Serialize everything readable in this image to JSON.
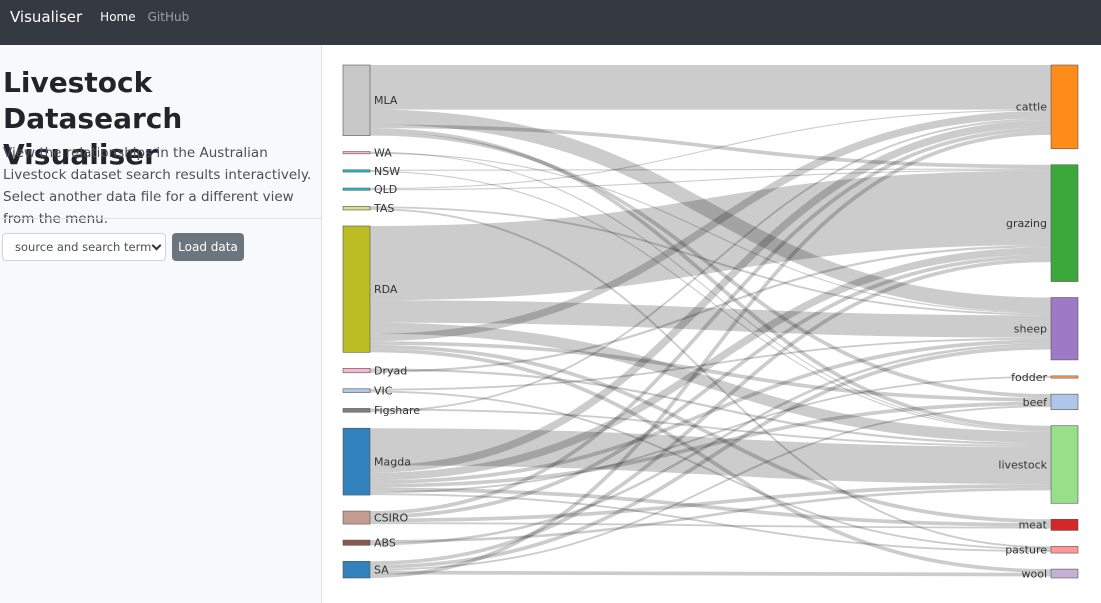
{
  "navbar": {
    "brand": "Visualiser",
    "links": [
      {
        "label": "Home",
        "active": true
      },
      {
        "label": "GitHub",
        "active": false
      }
    ]
  },
  "sidebar": {
    "title": "Livestock Datasearch Visualiser",
    "description": "View the relationships in the Australian Livestock dataset search results interactively. Select another data file for a different view from the menu.",
    "select_value": "source and search term",
    "load_button": "Load data"
  },
  "colors": {
    "navbar_bg": "#343a40",
    "link_color": "#aaaaaa"
  },
  "chart_data": {
    "type": "sankey",
    "sources": [
      {
        "name": "MLA",
        "color": "#c7c7c7"
      },
      {
        "name": "WA",
        "color": "#f7b6d2"
      },
      {
        "name": "NSW",
        "color": "#17becf"
      },
      {
        "name": "QLD",
        "color": "#17becf"
      },
      {
        "name": "TAS",
        "color": "#dbdb8d"
      },
      {
        "name": "RDA",
        "color": "#bcbd22"
      },
      {
        "name": "Dryad",
        "color": "#f7b6d2"
      },
      {
        "name": "VIC",
        "color": "#aec7e8"
      },
      {
        "name": "Figshare",
        "color": "#7f7f7f"
      },
      {
        "name": "Magda",
        "color": "#3182bd"
      },
      {
        "name": "CSIRO",
        "color": "#c49c94"
      },
      {
        "name": "ABS",
        "color": "#8c564b"
      },
      {
        "name": "SA",
        "color": "#3182bd"
      }
    ],
    "targets": [
      {
        "name": "cattle",
        "color": "#ff8c1a"
      },
      {
        "name": "grazing",
        "color": "#3ca83c"
      },
      {
        "name": "sheep",
        "color": "#9e79c6"
      },
      {
        "name": "fodder",
        "color": "#ff9f4a"
      },
      {
        "name": "beef",
        "color": "#aec7e8"
      },
      {
        "name": "livestock",
        "color": "#98df8a"
      },
      {
        "name": "meat",
        "color": "#d62728"
      },
      {
        "name": "pasture",
        "color": "#ff9896"
      },
      {
        "name": "wool",
        "color": "#c5b0d5"
      }
    ],
    "links": [
      {
        "source": "MLA",
        "target": "cattle",
        "value": 12
      },
      {
        "source": "MLA",
        "target": "sheep",
        "value": 4
      },
      {
        "source": "MLA",
        "target": "grazing",
        "value": 1
      },
      {
        "source": "MLA",
        "target": "livestock",
        "value": 1
      },
      {
        "source": "MLA",
        "target": "beef",
        "value": 1
      },
      {
        "source": "WA",
        "target": "livestock",
        "value": 0.3
      },
      {
        "source": "WA",
        "target": "sheep",
        "value": 0.3
      },
      {
        "source": "NSW",
        "target": "grazing",
        "value": 0.3
      },
      {
        "source": "NSW",
        "target": "livestock",
        "value": 0.3
      },
      {
        "source": "QLD",
        "target": "cattle",
        "value": 0.3
      },
      {
        "source": "QLD",
        "target": "grazing",
        "value": 0.3
      },
      {
        "source": "TAS",
        "target": "sheep",
        "value": 0.5
      },
      {
        "source": "TAS",
        "target": "pasture",
        "value": 0.5
      },
      {
        "source": "RDA",
        "target": "grazing",
        "value": 20
      },
      {
        "source": "RDA",
        "target": "sheep",
        "value": 6
      },
      {
        "source": "RDA",
        "target": "livestock",
        "value": 3
      },
      {
        "source": "RDA",
        "target": "cattle",
        "value": 2
      },
      {
        "source": "RDA",
        "target": "beef",
        "value": 1
      },
      {
        "source": "RDA",
        "target": "meat",
        "value": 1
      },
      {
        "source": "RDA",
        "target": "wool",
        "value": 1
      },
      {
        "source": "Dryad",
        "target": "livestock",
        "value": 0.6
      },
      {
        "source": "Dryad",
        "target": "grazing",
        "value": 0.6
      },
      {
        "source": "VIC",
        "target": "sheep",
        "value": 0.5
      },
      {
        "source": "VIC",
        "target": "pasture",
        "value": 0.5
      },
      {
        "source": "Figshare",
        "target": "livestock",
        "value": 0.5
      },
      {
        "source": "Figshare",
        "target": "cattle",
        "value": 0.5
      },
      {
        "source": "Magda",
        "target": "livestock",
        "value": 10
      },
      {
        "source": "Magda",
        "target": "cattle",
        "value": 2
      },
      {
        "source": "Magda",
        "target": "grazing",
        "value": 2
      },
      {
        "source": "Magda",
        "target": "sheep",
        "value": 1
      },
      {
        "source": "Magda",
        "target": "beef",
        "value": 1
      },
      {
        "source": "Magda",
        "target": "meat",
        "value": 1
      },
      {
        "source": "Magda",
        "target": "fodder",
        "value": 0.5
      },
      {
        "source": "Magda",
        "target": "pasture",
        "value": 0.5
      },
      {
        "source": "CSIRO",
        "target": "cattle",
        "value": 1
      },
      {
        "source": "CSIRO",
        "target": "grazing",
        "value": 1
      },
      {
        "source": "CSIRO",
        "target": "livestock",
        "value": 1
      },
      {
        "source": "CSIRO",
        "target": "meat",
        "value": 0.5
      },
      {
        "source": "ABS",
        "target": "livestock",
        "value": 0.7
      },
      {
        "source": "ABS",
        "target": "sheep",
        "value": 0.7
      },
      {
        "source": "SA",
        "target": "grazing",
        "value": 1
      },
      {
        "source": "SA",
        "target": "sheep",
        "value": 1
      },
      {
        "source": "SA",
        "target": "beef",
        "value": 0.5
      },
      {
        "source": "SA",
        "target": "wool",
        "value": 1
      },
      {
        "source": "SA",
        "target": "cattle",
        "value": 1
      }
    ]
  }
}
